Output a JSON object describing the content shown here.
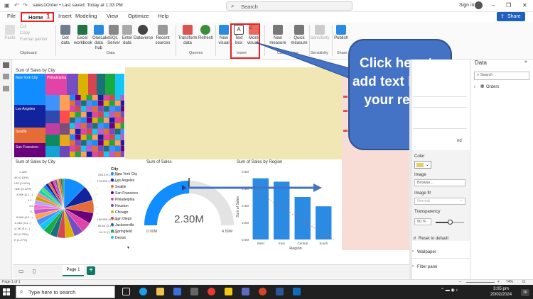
{
  "window": {
    "title": "sales1Order • Last saved: Today at 1:33 PM",
    "search_placeholder": "Search",
    "sign_in": "Sign in",
    "share": "Share"
  },
  "tabs": [
    "File",
    "Home",
    "Insert",
    "Modeling",
    "View",
    "Optimize",
    "Help"
  ],
  "step_labels": {
    "step1": "1",
    "step2": "2"
  },
  "ribbon": {
    "clipboard": {
      "paste": "Paste",
      "cut": "Cut",
      "copy": "Copy",
      "format_painter": "Format painter",
      "group": "Clipboard"
    },
    "data": {
      "get_data": "Get data",
      "excel": "Excel workbook",
      "hub": "OneLake data hub",
      "sql": "SQL Server",
      "enter": "Enter data",
      "dataverse": "Dataverse",
      "recent": "Recent sources",
      "group": "Data"
    },
    "queries": {
      "transform": "Transform data",
      "refresh": "Refresh",
      "group": "Queries"
    },
    "insert": {
      "new_visual": "New visual",
      "text_box": "Text box",
      "more_visuals": "More visuals",
      "group": "Insert"
    },
    "calculations": {
      "new_measure": "New measure",
      "quick_measure": "Quick measure",
      "group": "Calculations"
    },
    "sensitivity": {
      "label": "Sensitivity",
      "group": "Sensitivity"
    },
    "share": {
      "publish": "Publish",
      "group": "Share"
    }
  },
  "visuals": {
    "treemap_title": "Sum of Sales by City",
    "treemap_cities": [
      "New York City",
      "Philadelphia",
      "Los Angeles",
      "Seattle",
      "San Francisco"
    ],
    "pie_title": "Sum of Sales by City",
    "pie_legend_title": "City",
    "pie_legend": [
      "New York City",
      "Los Angeles",
      "Seattle",
      "San Francisco",
      "Philadelphia",
      "Houston",
      "Chicago",
      "San Diego",
      "Jacksonville",
      "Springfield",
      "Detroit"
    ],
    "pie_labels_left": [
      "0.42K",
      "3.44K (0.15%)",
      "2.12K (0.09%)",
      "2.84K (0.12%)",
      "3.38K (0.1...)",
      "4.1...",
      "4.6...",
      "5...",
      "8.96K (0.3...)",
      "10.34K (0.4...)",
      "12.3K (0.5...)",
      "17.35K (0.75%)",
      "29.34K (1.27%)"
    ],
    "pie_labels_right": [
      "256.37K (11.1%)",
      "175.85K (7.61%)",
      "...",
      "...",
      "...",
      "...",
      "...",
      "106.58K (4.73%)",
      "66.6K (3.1%)",
      "44.7K (1.94%)"
    ],
    "gauge_title": "Sum of Sales",
    "gauge_value": "2.30M",
    "gauge_min": "0.00M",
    "gauge_max": "4.59M",
    "bar_title": "Sum of Sales by Region",
    "bar_ylabel": "Sum of Sales",
    "bar_xlabel": "Region",
    "bar_yticks": [
      "0.8M",
      "0.6M",
      "0.4M",
      "0.2M",
      "0.0M"
    ],
    "bar_categories": [
      "West",
      "East",
      "Central",
      "South"
    ]
  },
  "callout": {
    "text": "Click here to add text box in your report"
  },
  "format_pane": {
    "color_label": "Color",
    "image_label": "Image",
    "image_value": "Browse...",
    "fit_label": "Image fit",
    "fit_value": "Normal",
    "transparency_label": "Transparency",
    "transparency_value": "50 %",
    "transparency_level": 0.5,
    "reset": "Reset to default",
    "wallpaper": "Wallpaper",
    "filter_pane": "Filter pane",
    "fill_color": "#e6cf6a"
  },
  "data_pane": {
    "title": "Data",
    "search_placeholder": "Search",
    "tables": [
      "Orders"
    ]
  },
  "pages": {
    "current": "Page 1",
    "add": "+"
  },
  "status": {
    "page_info": "Page 1 of 1",
    "zoom": "74%"
  },
  "taskbar": {
    "search_placeholder": "Type here to search",
    "time": "3:05 pm",
    "date": "20/02/2024",
    "notif": "26"
  },
  "chart_data": [
    {
      "type": "bar",
      "title": "Sum of Sales by Region",
      "xlabel": "Region",
      "ylabel": "Sum of Sales",
      "categories": [
        "West",
        "East",
        "Central",
        "South"
      ],
      "values": [
        0.72,
        0.68,
        0.5,
        0.39
      ],
      "ylim": [
        0,
        0.8
      ],
      "units": "M"
    }
  ],
  "colors": {
    "accent_red": "#e02424",
    "callout_blue": "#4472c4",
    "bar_blue": "#2b8ae2",
    "treemap_blue": "#118dff",
    "canvas_yellow": "#f1e7b4",
    "pink": "#f8ddd6"
  }
}
